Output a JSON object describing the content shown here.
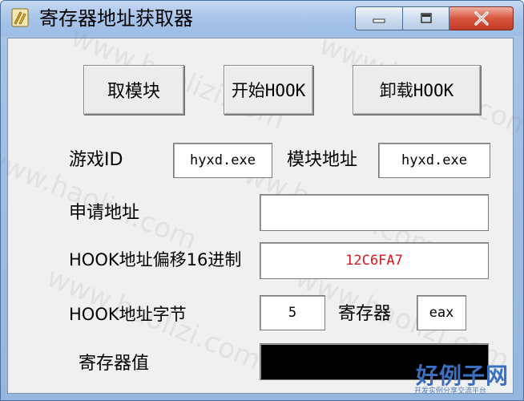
{
  "window": {
    "title": "寄存器地址获取器",
    "minimize_icon": "minimize-icon",
    "maximize_icon": "maximize-icon",
    "close_icon": "close-icon"
  },
  "buttons": {
    "get_module": "取模块",
    "start_hook": "开始HOOK",
    "unload_hook": "卸载HOOK"
  },
  "labels": {
    "game_id": "游戏ID",
    "module_address": "模块地址",
    "apply_address": "申请地址",
    "hook_offset_hex": "HOOK地址偏移16进制",
    "hook_bytes": "HOOK地址字节",
    "register": "寄存器",
    "register_value": "寄存器值"
  },
  "fields": {
    "game_id": "hyxd.exe",
    "module_address": "hyxd.exe",
    "apply_address": "",
    "hook_offset_hex": "12C6FA7",
    "hook_bytes": "5",
    "register": "eax",
    "register_value": ""
  },
  "watermark": {
    "text": "www.haolizi.com",
    "logo_main": "好例子网",
    "logo_sub": "开发实例分享交流平台"
  },
  "colors": {
    "offset_text": "#e0141e",
    "register_value_bg": "#000000"
  }
}
